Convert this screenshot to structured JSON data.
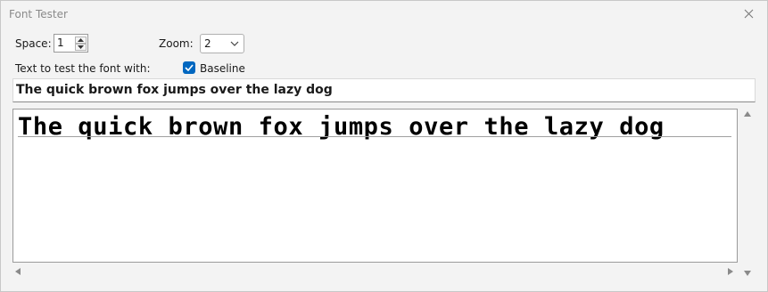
{
  "window": {
    "title": "Font Tester"
  },
  "controls": {
    "space_label": "Space:",
    "space_value": "1",
    "zoom_label": "Zoom:",
    "zoom_value": "2",
    "text_label": "Text to test the font with:",
    "baseline_label": "Baseline",
    "baseline_checked": true
  },
  "sample_text": "The quick brown fox jumps over the lazy dog",
  "preview_text": "The quick brown fox jumps over the lazy dog",
  "colors": {
    "accent": "#0067c0"
  },
  "icons": [
    "close-icon",
    "spin-up-icon",
    "spin-down-icon",
    "chevron-down-icon",
    "checkmark-icon",
    "scroll-arrow-up-icon",
    "scroll-arrow-down-icon",
    "scroll-arrow-left-icon",
    "scroll-arrow-right-icon"
  ]
}
